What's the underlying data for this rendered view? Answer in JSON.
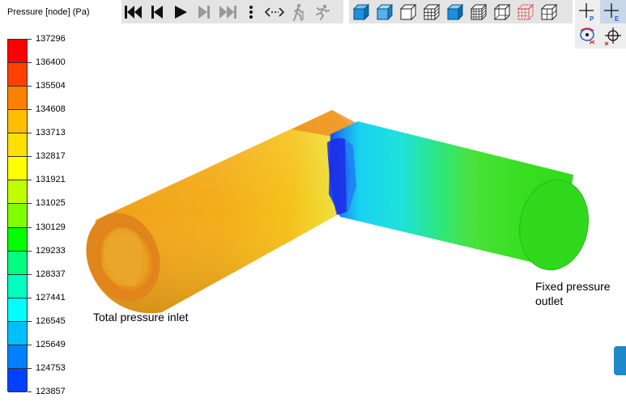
{
  "legend": {
    "title": "Pressure [node] (Pa)",
    "values": [
      "137296",
      "136400",
      "135504",
      "134608",
      "133713",
      "132817",
      "131921",
      "131025",
      "130129",
      "129233",
      "128337",
      "127441",
      "126545",
      "125649",
      "124753",
      "123857"
    ],
    "colors": [
      "#ff0000",
      "#ff4000",
      "#ff8000",
      "#ffbf00",
      "#ffe000",
      "#ffff00",
      "#bfff00",
      "#80ff00",
      "#00ff00",
      "#00ff80",
      "#00ffbf",
      "#00ffff",
      "#00bfff",
      "#0080ff",
      "#0040ff"
    ]
  },
  "annotations": {
    "inlet": "Total pressure inlet",
    "outlet_line1": "Fixed pressure",
    "outlet_line2": "outlet"
  },
  "toolbar": {
    "playback": [
      "skip-to-start-icon",
      "step-back-icon",
      "play-icon",
      "step-forward-icon",
      "skip-to-end-icon",
      "more-options-icon",
      "bounce-loop-icon",
      "walk-icon",
      "run-icon"
    ],
    "views": [
      "solid-view-icon",
      "shaded-view-icon",
      "outline-view-icon",
      "mesh-view-icon",
      "solid-mesh-view-icon",
      "wireframe-view-icon",
      "edges-view-icon",
      "hidden-mesh-view-icon",
      "transparent-view-icon"
    ]
  }
}
